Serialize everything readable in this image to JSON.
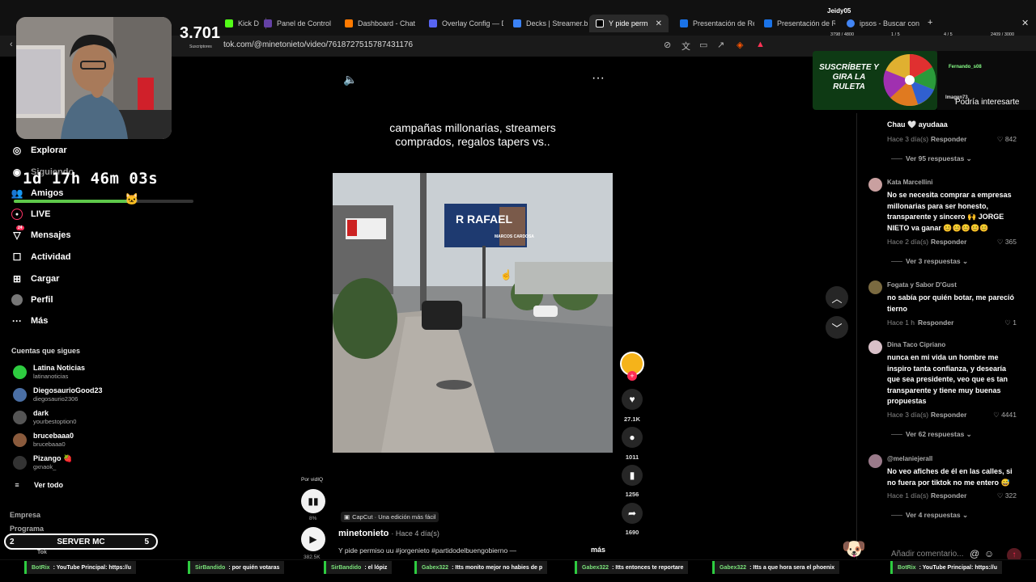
{
  "browser": {
    "tabs": [
      {
        "label": "Kick D",
        "icon_color": "#53fc18"
      },
      {
        "label": "Panel de Control - T",
        "icon_color": "#6441a5"
      },
      {
        "label": "Dashboard - Chat U",
        "icon_color": "#ff7a00"
      },
      {
        "label": "Overlay Config — D",
        "icon_color": "#5865f2"
      },
      {
        "label": "Decks | Streamer.bo",
        "icon_color": "#3b82f6"
      },
      {
        "label": "Y pide perm",
        "icon_color": "#ffffff"
      },
      {
        "label": "Presentación de Re",
        "icon_color": "#1a73e8"
      },
      {
        "label": "Presentación de Re",
        "icon_color": "#1a73e8"
      },
      {
        "label": "ipsos - Buscar con G",
        "icon_color": "#4285f4"
      }
    ],
    "url": "tok.com/@minetonieto/video/7618727515787431176",
    "top_user": "Jeidy05",
    "stats": [
      "3798 / 4800",
      "1 / 5",
      "4 / 5",
      "2409 / 3000"
    ]
  },
  "sidebar": {
    "nav": [
      {
        "label": "Explorar",
        "icon": "compass-icon"
      },
      {
        "label": "Siguiendo",
        "icon": "following-icon"
      },
      {
        "label": "Amigos",
        "icon": "friends-icon"
      },
      {
        "label": "LIVE",
        "icon": "live-icon"
      },
      {
        "label": "Mensajes",
        "icon": "messages-icon",
        "badge": "24"
      },
      {
        "label": "Actividad",
        "icon": "activity-icon"
      },
      {
        "label": "Cargar",
        "icon": "upload-icon"
      },
      {
        "label": "Perfil",
        "icon": "profile-icon"
      },
      {
        "label": "Más",
        "icon": "more-icon"
      }
    ],
    "following_title": "Cuentas que sigues",
    "following": [
      {
        "name": "Latina Noticias",
        "handle": "latinanoticias",
        "color": "#2ecc40"
      },
      {
        "name": "DiegosaurioGood23",
        "handle": "diegosaurio2306",
        "color": "#4a6fa5"
      },
      {
        "name": "dark",
        "handle": "yourbestoption0",
        "color": "#555555"
      },
      {
        "name": "brucebaaa0",
        "handle": "brucebaaa0",
        "color": "#8a5a3c"
      },
      {
        "name": "Pizango 🍓",
        "handle": "gxnaok_",
        "color": "#333333"
      }
    ],
    "see_all": "Ver todo",
    "footer": [
      "Empresa",
      "Programa",
      "Tok"
    ]
  },
  "overlay": {
    "subs_count": "3.701",
    "subs_label": "Suscriptores",
    "timer": "1d 17h 46m 03s",
    "timer_progress": 0.68,
    "roulette_text": "SUSCRÍBETE Y GIRA LA RULETA",
    "roulette_user1": "Fernando_s08",
    "roulette_user2": "Imagen73",
    "server_label": "SERVER MC",
    "server_left": "2",
    "server_right": "5"
  },
  "video": {
    "caption": "campañas millonarias, streamers comprados, regalos tapers vs..",
    "billboard_top": "R RAFAEL",
    "billboard_side": "MARCOS CARDOSA",
    "author": "minetonieto",
    "date": "· Hace 4 día(s)",
    "description": "Y pide permiso uu #jorgenieto #partidodelbuengobierno —",
    "more": "más",
    "capcut": "CapCut · Una edición más fácil",
    "por_vidiq": "Por vidIQ",
    "small_percent": "8%",
    "small_value": "382.5K"
  },
  "actions": {
    "likes": "27.1K",
    "comments": "1011",
    "saves": "1256",
    "shares": "1690"
  },
  "comments_panel": {
    "title": "Podría interesarte",
    "add_placeholder": "Añadir comentario...",
    "items": [
      {
        "text": "Chau 🤍 ayudaaa",
        "meta": "Hace 3 día(s)",
        "reply": "Responder",
        "likes": "842",
        "more": "Ver 95 respuestas"
      },
      {
        "name": "Kata Marcellini",
        "text": "No se necesita comprar a empresas millonarias para ser honesto, transparente y sincero 🙌 JORGE NIETO va ganar 😊😊😊😊😊",
        "meta": "Hace 2 día(s)",
        "reply": "Responder",
        "likes": "365",
        "more": "Ver 3 respuestas",
        "color": "#c9a0a0"
      },
      {
        "name": "Fogata y Sabor D'Gust",
        "text": "no sabía por quién botar, me pareció tierno",
        "meta": "Hace 1 h",
        "reply": "Responder",
        "likes": "1",
        "color": "#7a6a40"
      },
      {
        "name": "Dina Taco Cipriano",
        "text": "nunca en mi vida un hombre me inspiro tanta confianza, y desearía que sea presidente, veo que es tan transparente y tiene muy buenas propuestas",
        "meta": "Hace 3 día(s)",
        "reply": "Responder",
        "likes": "4441",
        "more": "Ver 62 respuestas",
        "color": "#d8c0c8"
      },
      {
        "name": "@melaniejerall",
        "text": "No veo afiches de él en las calles, si no fuera por tiktok no me entero 😅",
        "meta": "Hace 1 día(s)",
        "reply": "Responder",
        "likes": "322",
        "more": "Ver 4 respuestas",
        "color": "#9a7a8a"
      }
    ]
  },
  "ticker": [
    {
      "user": "BotRix",
      "text": ": YouTube Principal: https://u"
    },
    {
      "user": "SirBandido",
      "text": ": por quién votaras"
    },
    {
      "user": "SirBandido",
      "text": ": el lópiz"
    },
    {
      "user": "Gabex322",
      "text": ": Itts monito mejor no habies de p"
    },
    {
      "user": "Gabex322",
      "text": ": Itts entonces te reportare"
    },
    {
      "user": "Gabex322",
      "text": ": Itts a que hora sera el phoenix"
    },
    {
      "user": "BotRix",
      "text": ": YouTube Principal: https://u"
    }
  ]
}
